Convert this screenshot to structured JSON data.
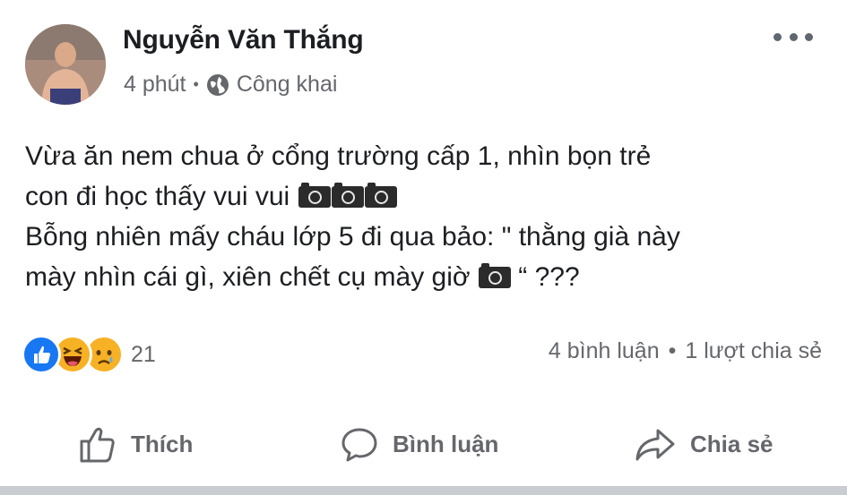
{
  "post": {
    "author": "Nguyễn Văn Thắng",
    "time": "4 phút",
    "meta_separator": "•",
    "privacy": "Công khai",
    "text": {
      "line1": "Vừa ăn nem chua ở cổng trường cấp 1, nhìn bọn trẻ",
      "line2": "con đi học thấy vui vui",
      "line3": "Bỗng nhiên mấy cháu lớp 5 đi qua bảo: \" thằng già này",
      "line4": "mày nhìn cái gì, xiên chết cụ mày giờ",
      "line4_end": " “ ???"
    },
    "stats": {
      "reaction_count": "21",
      "reactions": [
        "like",
        "haha",
        "sad"
      ],
      "comments": "4 bình luận",
      "separator": "•",
      "shares": "1 lượt chia sẻ"
    },
    "actions": {
      "like": "Thích",
      "comment": "Bình luận",
      "share": "Chia sẻ"
    }
  },
  "colors": {
    "text": "#1c1e21",
    "secondary": "#65676b",
    "like_blue": "#1877f2",
    "reaction_yellow": "#f7b125"
  }
}
